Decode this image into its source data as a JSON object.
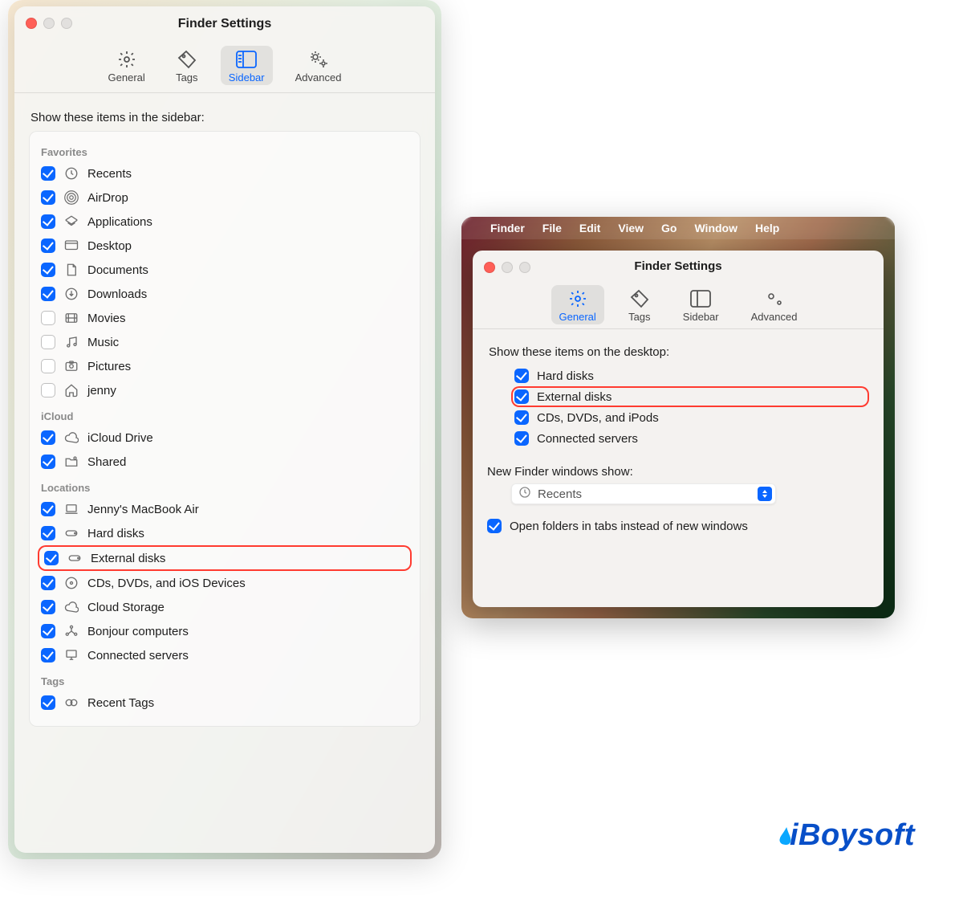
{
  "left": {
    "windowTitle": "Finder Settings",
    "tabs": {
      "general": "General",
      "tags": "Tags",
      "sidebar": "Sidebar",
      "advanced": "Advanced",
      "active": "Sidebar"
    },
    "heading": "Show these items in the sidebar:",
    "groups": {
      "favorites": "Favorites",
      "icloud": "iCloud",
      "locations": "Locations",
      "tags": "Tags"
    },
    "favorites": [
      {
        "label": "Recents",
        "checked": true,
        "icon": "clock-icon"
      },
      {
        "label": "AirDrop",
        "checked": true,
        "icon": "airdrop-icon"
      },
      {
        "label": "Applications",
        "checked": true,
        "icon": "app-icon"
      },
      {
        "label": "Desktop",
        "checked": true,
        "icon": "desktop-icon"
      },
      {
        "label": "Documents",
        "checked": true,
        "icon": "doc-icon"
      },
      {
        "label": "Downloads",
        "checked": true,
        "icon": "download-icon"
      },
      {
        "label": "Movies",
        "checked": false,
        "icon": "movies-icon"
      },
      {
        "label": "Music",
        "checked": false,
        "icon": "music-icon"
      },
      {
        "label": "Pictures",
        "checked": false,
        "icon": "pictures-icon"
      },
      {
        "label": "jenny",
        "checked": false,
        "icon": "home-icon"
      }
    ],
    "icloud": [
      {
        "label": "iCloud Drive",
        "checked": true,
        "icon": "cloud-icon"
      },
      {
        "label": "Shared",
        "checked": true,
        "icon": "shared-folder-icon"
      }
    ],
    "locations": [
      {
        "label": "Jenny's MacBook Air",
        "checked": true,
        "icon": "laptop-icon"
      },
      {
        "label": "Hard disks",
        "checked": true,
        "icon": "disk-icon"
      },
      {
        "label": "External disks",
        "checked": true,
        "icon": "disk-icon",
        "highlight": true
      },
      {
        "label": "CDs, DVDs, and iOS Devices",
        "checked": true,
        "icon": "cd-icon"
      },
      {
        "label": "Cloud Storage",
        "checked": true,
        "icon": "cloud-icon"
      },
      {
        "label": "Bonjour computers",
        "checked": true,
        "icon": "network-icon"
      },
      {
        "label": "Connected servers",
        "checked": true,
        "icon": "server-icon"
      }
    ],
    "tags": [
      {
        "label": "Recent Tags",
        "checked": true,
        "icon": "tags-icon"
      }
    ]
  },
  "right": {
    "menubar": [
      "Finder",
      "File",
      "Edit",
      "View",
      "Go",
      "Window",
      "Help"
    ],
    "windowTitle": "Finder Settings",
    "tabs": {
      "general": "General",
      "tags": "Tags",
      "sidebar": "Sidebar",
      "advanced": "Advanced",
      "active": "General"
    },
    "heading": "Show these items on the desktop:",
    "desktopItems": [
      {
        "label": "Hard disks",
        "checked": true
      },
      {
        "label": "External disks",
        "checked": true,
        "highlight": true
      },
      {
        "label": "CDs, DVDs, and iPods",
        "checked": true
      },
      {
        "label": "Connected servers",
        "checked": true
      }
    ],
    "newFinderWindowsLabel": "New Finder windows show:",
    "newFinderWindowsValue": "Recents",
    "openInTabs": {
      "label": "Open folders in tabs instead of new windows",
      "checked": true
    }
  },
  "brand": "iBoysoft"
}
